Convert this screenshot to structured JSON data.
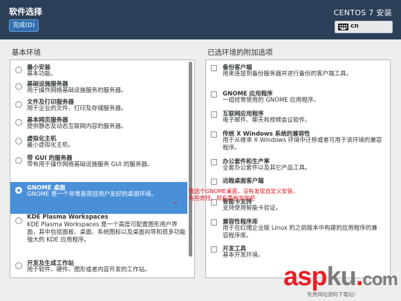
{
  "header": {
    "title": "软件选择",
    "done_label": "完成(D)",
    "product": "CENTOS 7 安装",
    "keyboard": "cn"
  },
  "base_env": {
    "title": "基本环境",
    "items": [
      {
        "name": "最小安装",
        "desc": "基本功能。"
      },
      {
        "name": "基础设施服务器",
        "desc": "用于操作网络基础设施服务的服务器。"
      },
      {
        "name": "文件及打印服务器",
        "desc": "用于企业的文件、打印及存储服务器。"
      },
      {
        "name": "基本网页服务器",
        "desc": "提供静态及动态互联网内容的服务器。"
      },
      {
        "name": "虚拟化主机",
        "desc": "最小虚拟化主机。"
      },
      {
        "name": "带 GUI 的服务器",
        "desc": "带有用于操作网络基础设施服务 GUI 的服务器。"
      },
      {
        "name": "GNOME 桌面",
        "desc": "GNOME 是一个非常直观且用户友好的桌面环境。"
      },
      {
        "name": "KDE Plasma Workspaces",
        "desc": "KDE Plasma Workspaces 是一个高度可配置图形用户界面，其中包括面板、桌面、系统图标以及桌面向导和很多功能强大的 KDE 应用程序。"
      },
      {
        "name": "开发及生成工作站",
        "desc": "用于软件、硬件、图形或者内容开发的工作站。"
      }
    ],
    "selected_index": 6
  },
  "addons": {
    "title": "已选环境的附加选项",
    "items": [
      {
        "name": "备份客户端",
        "desc": "用来连接到备份服务器并进行备份的客户端工具。"
      },
      {
        "name": "GNOME 应用程序",
        "desc": "一组经常使用的 GNOME 应用程序。"
      },
      {
        "name": "互联网应用程序",
        "desc": "电子邮件、聊天和视频会议软件。"
      },
      {
        "name": "传统 X Windows 系统的兼容性",
        "desc": "用于从继承 X Windows 环境中迁移或者可用于该环境的兼容程序。"
      },
      {
        "name": "办公套件和生产率",
        "desc": "全套办公套件以及其它产品工具。"
      },
      {
        "name": "远程桌面客户端",
        "desc": ""
      },
      {
        "name": "智能卡支持",
        "desc": "支持使用智能卡验证。"
      },
      {
        "name": "兼容性程序库",
        "desc": "用于在红帽企业版 Linux 的之前版本中构建的应用程序的兼容程序库。"
      },
      {
        "name": "开发工具",
        "desc": "基本开发环境。"
      }
    ]
  },
  "annotation": {
    "line1": "我选个GNOME桌面，没有发现自定义安装，",
    "line2": "有些奇怪，现在重新安装吧"
  },
  "watermark": {
    "asp": "asp",
    "ku": "ku",
    "dot": ".",
    "com": "com",
    "sub": "免费网站源码下载站!"
  },
  "colors": {
    "header_bg": "#2c3f58",
    "selection": "#4a90d9",
    "annotation": "#e0141c",
    "watermark_red": "#e81e25"
  }
}
